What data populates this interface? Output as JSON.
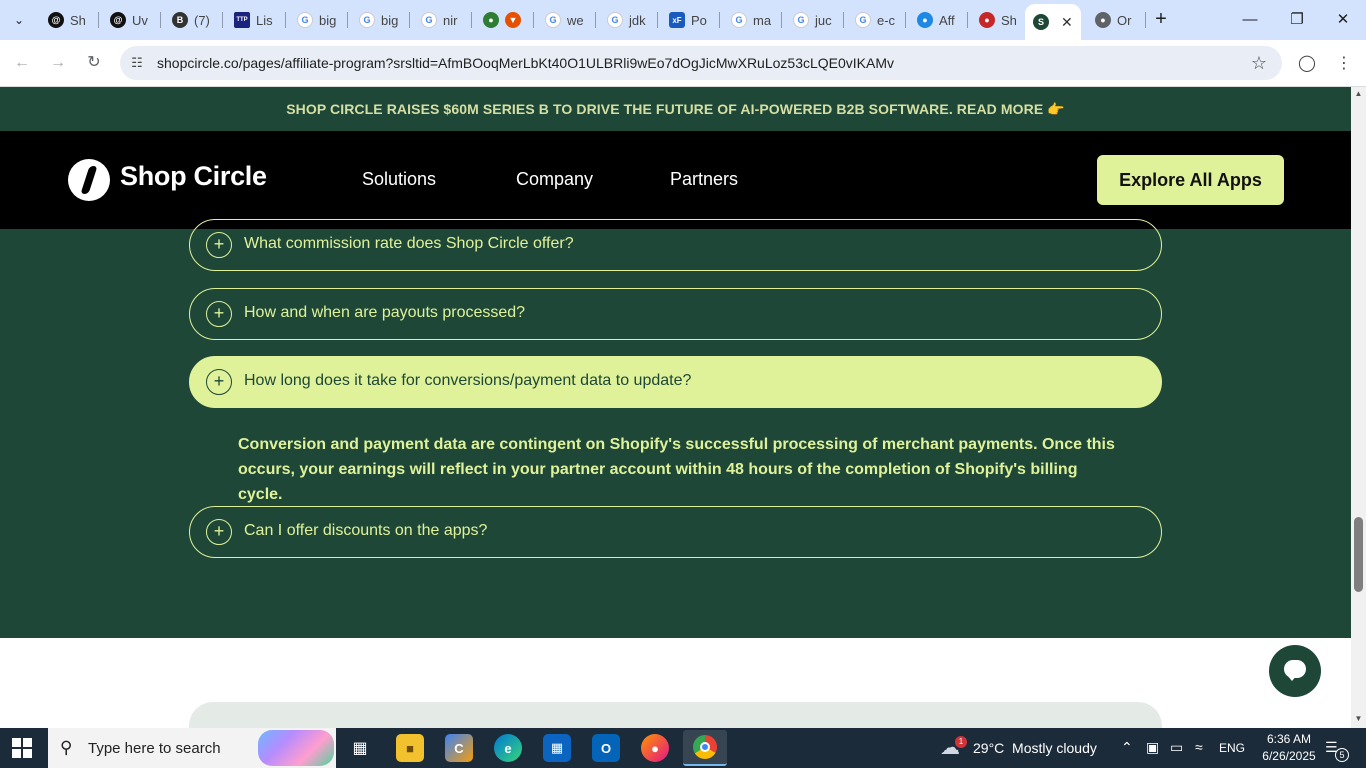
{
  "browser": {
    "tabs": [
      {
        "label": "Sh",
        "icon": "threads-icon",
        "color": "#111111"
      },
      {
        "label": "Uv",
        "icon": "threads-icon",
        "color": "#111111"
      },
      {
        "label": "(7)",
        "icon": "notification-icon",
        "color": "#333333"
      },
      {
        "label": "Lis",
        "icon": "ttp-icon",
        "color": "#1a237e"
      },
      {
        "label": "big",
        "icon": "google-icon",
        "color": "#4285f4"
      },
      {
        "label": "big",
        "icon": "google-icon",
        "color": "#4285f4"
      },
      {
        "label": "nir",
        "icon": "google-icon",
        "color": "#4285f4"
      },
      {
        "label": "",
        "icon": "extension-icon",
        "color": "#2e7d32"
      },
      {
        "label": "we",
        "icon": "google-icon",
        "color": "#4285f4"
      },
      {
        "label": "jdk",
        "icon": "google-icon",
        "color": "#4285f4"
      },
      {
        "label": "Po",
        "icon": "xf-icon",
        "color": "#185abd"
      },
      {
        "label": "ma",
        "icon": "google-icon",
        "color": "#4285f4"
      },
      {
        "label": "juc",
        "icon": "google-icon",
        "color": "#4285f4"
      },
      {
        "label": "e-c",
        "icon": "google-icon",
        "color": "#4285f4"
      },
      {
        "label": "Aff",
        "icon": "site-icon",
        "color": "#1e88e5"
      },
      {
        "label": "Sh",
        "icon": "site-icon",
        "color": "#c62828"
      },
      {
        "label": "",
        "icon": "shopcircle-icon",
        "color": "#1e4737",
        "active": true
      },
      {
        "label": "Or",
        "icon": "globe-icon",
        "color": "#5f6368"
      }
    ],
    "url": "shopcircle.co/pages/affiliate-program?srsltid=AfmBOoqMerLbKt40O1ULBRli9wEo7dOgJicMwXRuLoz53cLQE0vIKAMv"
  },
  "page": {
    "announcement": "SHOP CIRCLE RAISES $60M SERIES B TO DRIVE THE FUTURE OF AI-POWERED B2B SOFTWARE. READ MORE 👉",
    "logo_text": "Shop Circle",
    "nav": [
      "Solutions",
      "Company",
      "Partners"
    ],
    "cta": "Explore All Apps",
    "faq": [
      {
        "question": "What commission rate does Shop Circle offer?",
        "open": false
      },
      {
        "question": "How and when are payouts processed?",
        "open": false
      },
      {
        "question": "How long does it take for conversions/payment data to update?",
        "open": true
      },
      {
        "question": "Can I offer discounts on the apps?",
        "open": false
      }
    ],
    "faq_answer": "Conversion and payment data are contingent on Shopify's successful processing of merchant payments. Once this occurs, your earnings will reflect in your partner account within 48 hours of the completion of Shopify's billing cycle.",
    "plus_symbol": "+"
  },
  "taskbar": {
    "search_placeholder": "Type here to search",
    "weather": "29°C  Mostly cloudy",
    "weather_badge": "1",
    "language": "ENG",
    "time": "6:36 AM",
    "date": "6/26/2025",
    "notification_count": "5"
  },
  "colors": {
    "brand_green": "#1e4737",
    "brand_lime": "#dff29a"
  }
}
